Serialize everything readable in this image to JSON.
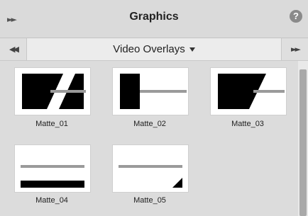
{
  "panel": {
    "title": "Graphics",
    "collapse_icon": "double-chevron-right",
    "help_icon": "?"
  },
  "subbar": {
    "left_icon": "double-chevron-left",
    "right_icon": "double-chevron-right",
    "dropdown_label": "Video Overlays"
  },
  "items": [
    {
      "label": "Matte_01"
    },
    {
      "label": "Matte_02"
    },
    {
      "label": "Matte_03"
    },
    {
      "label": "Matte_04"
    },
    {
      "label": "Matte_05"
    }
  ],
  "colors": {
    "titlebar_bg": "#dadada",
    "content_bg": "#dcdcdc",
    "thumb_bg": "#ffffff",
    "matte_black": "#000000",
    "matte_gray_line": "#9a9a9a",
    "scrollbar": "#a9a9a9"
  }
}
